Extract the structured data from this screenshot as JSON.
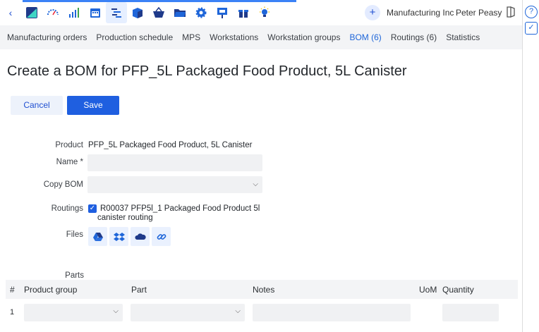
{
  "topbar": {
    "company": "Manufacturing Inc",
    "user": "Peter Peasy",
    "plus": "+",
    "back": "‹"
  },
  "nav": [
    "Manufacturing orders",
    "Production schedule",
    "MPS",
    "Workstations",
    "Workstation groups",
    "BOM (6)",
    "Routings (6)",
    "Statistics"
  ],
  "nav_active": "BOM (6)",
  "title": "Create a BOM for PFP_5L Packaged Food Product, 5L Canister",
  "actions": {
    "cancel": "Cancel",
    "save": "Save"
  },
  "form": {
    "product_label": "Product",
    "product_value": "PFP_5L Packaged Food Product, 5L Canister",
    "name_label": "Name *",
    "name_value": "",
    "copy_label": "Copy BOM",
    "copy_value": "",
    "routings_label": "Routings",
    "routing_line1": "R00037 PFP5l_1 Packaged Food Product 5l",
    "routing_line2": "canister routing",
    "files_label": "Files",
    "parts_label": "Parts"
  },
  "table": {
    "headers": {
      "num": "#",
      "group": "Product group",
      "part": "Part",
      "notes": "Notes",
      "uom": "UoM",
      "qty": "Quantity"
    },
    "rows": [
      {
        "num": "1"
      }
    ]
  },
  "colors": {
    "accent": "#1f5fe0",
    "link": "#1f66d9"
  }
}
